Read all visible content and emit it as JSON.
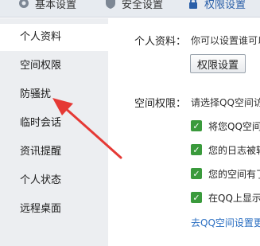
{
  "tabs": {
    "basic": "基本设置",
    "security": "安全设置",
    "permission": "权限设置"
  },
  "sidebar": {
    "items": [
      {
        "label": "个人资料"
      },
      {
        "label": "空间权限"
      },
      {
        "label": "防骚扰"
      },
      {
        "label": "临时会话"
      },
      {
        "label": "资讯提醒"
      },
      {
        "label": "个人状态"
      },
      {
        "label": "远程桌面"
      }
    ],
    "active_index": 0
  },
  "main": {
    "profile": {
      "label": "个人资料：",
      "desc": "你可以设置谁可以",
      "button": "权限设置"
    },
    "space": {
      "label": "空间权限：",
      "desc": "请选择QQ空间访",
      "options": [
        {
          "text": "将您QQ空间",
          "checked": true
        },
        {
          "text": "您的日志被转",
          "checked": true
        },
        {
          "text": "您的空间有了",
          "checked": true
        },
        {
          "text": "在QQ上显示",
          "checked": true
        }
      ],
      "link": "去QQ空间设置更"
    }
  },
  "colors": {
    "accent": "#2a5fa8",
    "check": "#3a9a3c",
    "sidebar_bg": "#eceef1",
    "arrow": "#e53935"
  }
}
